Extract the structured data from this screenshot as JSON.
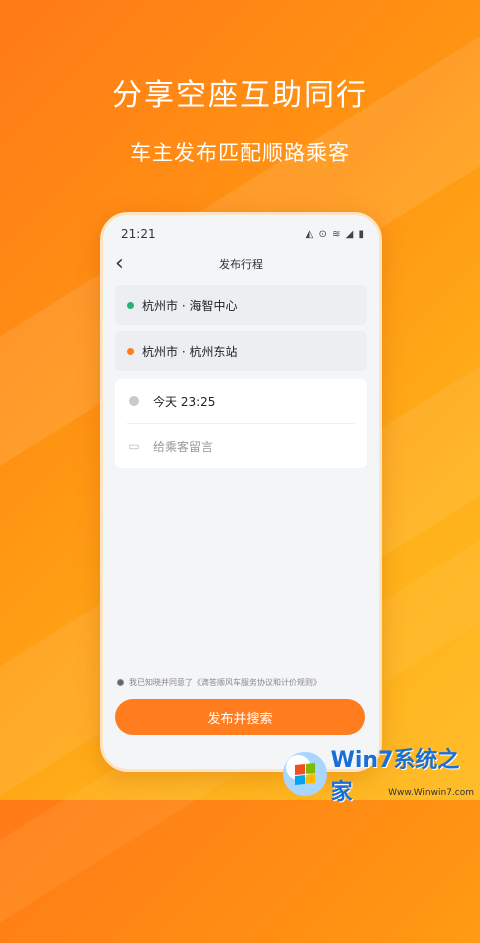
{
  "headline": "分享空座互助同行",
  "subheadline": "车主发布匹配顺路乘客",
  "phone": {
    "status_time": "21:21",
    "status_icons": "◭ ⊙ ≋ ◢ ▮",
    "nav_title": "发布行程",
    "back_glyph": "‹",
    "origin": "杭州市 · 海智中心",
    "destination": "杭州市 · 杭州东站",
    "time_value": "今天 23:25",
    "message_placeholder": "给乘客留言",
    "agreement_text": "我已知晓并同意了《滴答顺风车服务协议和计价规则》",
    "submit_label": "发布并搜索"
  },
  "watermark": {
    "title": "Win7系统之家",
    "url": "Www.Winwin7.com"
  },
  "colors": {
    "accent": "#ff7d1f",
    "origin_dot": "#22b573",
    "destination_dot": "#ff7d1f"
  }
}
